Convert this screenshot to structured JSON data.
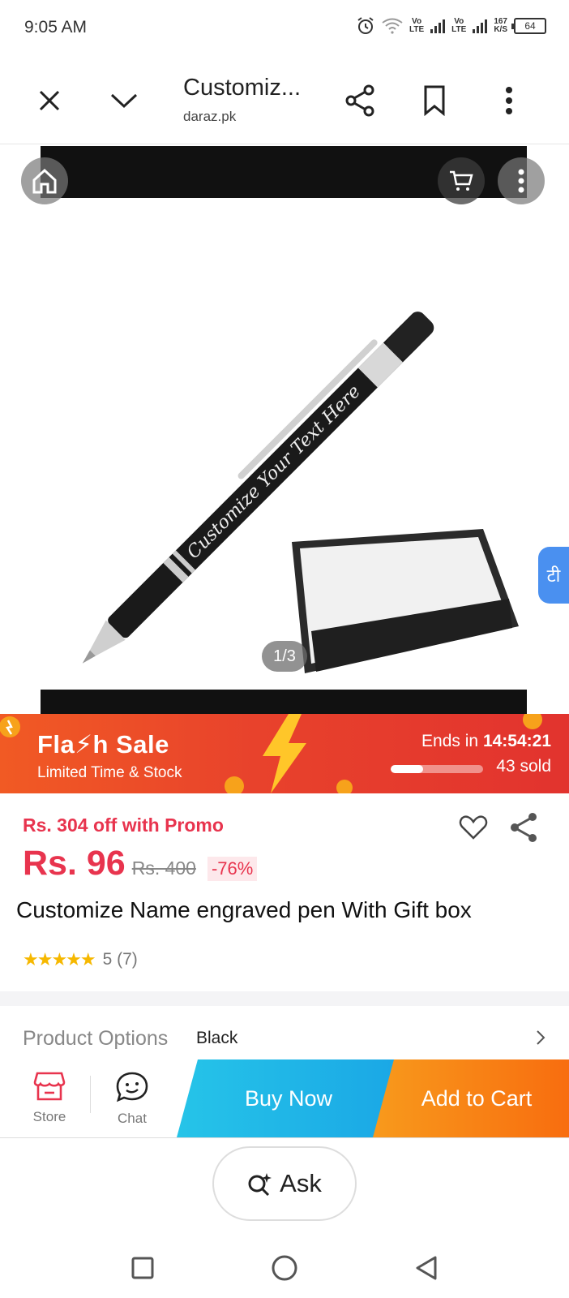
{
  "status": {
    "time": "9:05 AM",
    "vo1": "Vo",
    "lte1": "LTE",
    "vo2": "Vo",
    "lte2": "LTE",
    "speed_value": "167",
    "speed_unit": "K/S",
    "battery": "64"
  },
  "browser": {
    "title": "Customiz...",
    "url": "daraz.pk",
    "icons": [
      "close-icon",
      "chevron-down-icon",
      "share-icon",
      "bookmark-icon",
      "more-vertical-icon"
    ]
  },
  "gallery": {
    "counter": "1/3",
    "pen_text": "Customize Your Text Here",
    "translate_label": "टी"
  },
  "flash_sale": {
    "title": "Fla⚡h Sale",
    "subtitle": "Limited Time & Stock",
    "ends_label": "Ends in",
    "countdown": "14:54:21",
    "sold": "43 sold",
    "progress": 0.35
  },
  "price": {
    "promo": "Rs. 304 off with Promo",
    "current": "Rs. 96",
    "original": "Rs. 400",
    "discount": "-76%"
  },
  "product": {
    "title": "Customize Name engraved pen With Gift box",
    "stars": "★★★★★",
    "rating_text": "5 (7)"
  },
  "options": {
    "label": "Product Options",
    "value": "Black"
  },
  "actions": {
    "store": "Store",
    "chat": "Chat",
    "buy_now": "Buy Now",
    "add_to_cart": "Add to Cart"
  },
  "ask": {
    "label": "Ask"
  },
  "colors": {
    "brand_red": "#e8344e",
    "flash_orange": "#f15a24",
    "buy_blue": "#1aa7e6",
    "cart_orange": "#f86d0f"
  }
}
